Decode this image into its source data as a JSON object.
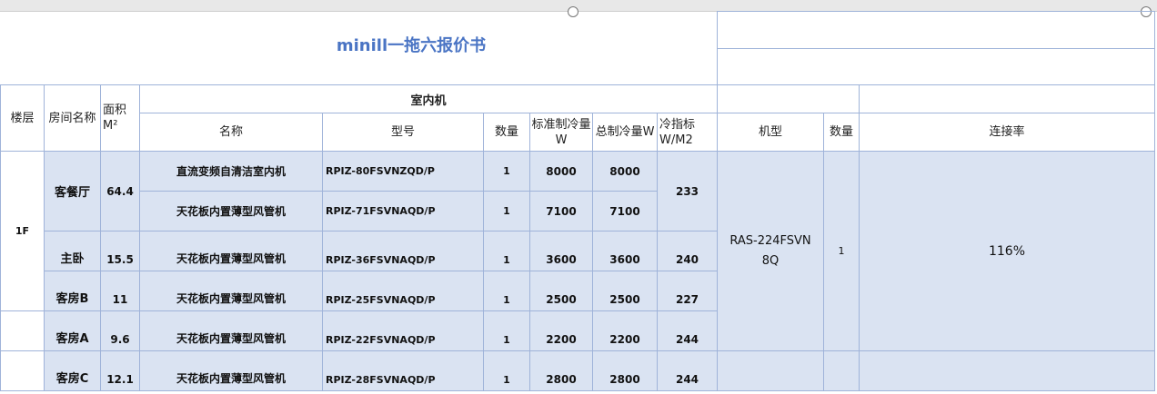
{
  "sheet": {
    "title": "minill一拖六报价书",
    "headers": {
      "floor": "楼层",
      "room_name": "房间名称",
      "area": "面积M²",
      "indoor_unit": "室内机",
      "name": "名称",
      "model": "型号",
      "qty": "数量",
      "std_cooling": "标准制冷量W",
      "total_cooling": "总制冷量W",
      "cooling_index": "冷指标W/M2",
      "outdoor_model": "机型",
      "outdoor_qty": "数量",
      "connection_rate": "连接率"
    },
    "floor_value": "1F",
    "rooms": [
      {
        "room": "客餐厅",
        "area": "64.4",
        "index": "233"
      },
      {
        "room": "主卧",
        "area": "15.5",
        "index": "240"
      },
      {
        "room": "客房B",
        "area": "11",
        "index": "227"
      },
      {
        "room": "客房A",
        "area": "9.6",
        "index": "244"
      },
      {
        "room": "客房C",
        "area": "12.1",
        "index": "244"
      }
    ],
    "units": [
      {
        "name": "直流变频自清洁室内机",
        "model": "RPIZ-80FSVNZQD/P",
        "qty": "1",
        "std": "8000",
        "total": "8000"
      },
      {
        "name": "天花板内置薄型风管机",
        "model": "RPIZ-71FSVNAQD/P",
        "qty": "1",
        "std": "7100",
        "total": "7100"
      },
      {
        "name": "天花板内置薄型风管机",
        "model": "RPIZ-36FSVNAQD/P",
        "qty": "1",
        "std": "3600",
        "total": "3600"
      },
      {
        "name": "天花板内置薄型风管机",
        "model": "RPIZ-25FSVNAQD/P",
        "qty": "1",
        "std": "2500",
        "total": "2500"
      },
      {
        "name": "天花板内置薄型风管机",
        "model": "RPIZ-22FSVNAQD/P",
        "qty": "1",
        "std": "2200",
        "total": "2200"
      },
      {
        "name": "天花板内置薄型风管机",
        "model": "RPIZ-28FSVNAQD/P",
        "qty": "1",
        "std": "2800",
        "total": "2800"
      }
    ],
    "outdoor": {
      "model": "RAS-224FSVN8Q",
      "qty": "1",
      "connection_rate": "116%"
    }
  }
}
